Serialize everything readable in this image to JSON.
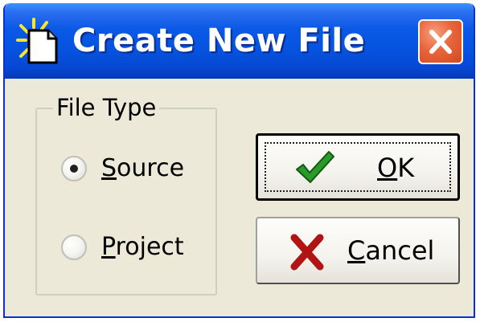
{
  "window": {
    "title": "Create New File"
  },
  "file_type": {
    "group_label": "File Type",
    "options": [
      {
        "mnemonic": "S",
        "rest": "ource",
        "selected": true
      },
      {
        "mnemonic": "P",
        "rest": "roject",
        "selected": false
      }
    ]
  },
  "buttons": {
    "ok": {
      "mnemonic": "O",
      "rest": "K"
    },
    "cancel": {
      "mnemonic": "C",
      "rest": "ancel"
    }
  },
  "icons": {
    "title": "new-file-icon",
    "close": "close-icon",
    "ok": "checkmark-icon",
    "cancel": "x-icon"
  },
  "colors": {
    "titlebar": "#0654e0",
    "dialog_bg": "#ece9d8",
    "close_button": "#e8653c",
    "checkmark": "#1f8a1f",
    "cancel_x": "#b01010"
  }
}
